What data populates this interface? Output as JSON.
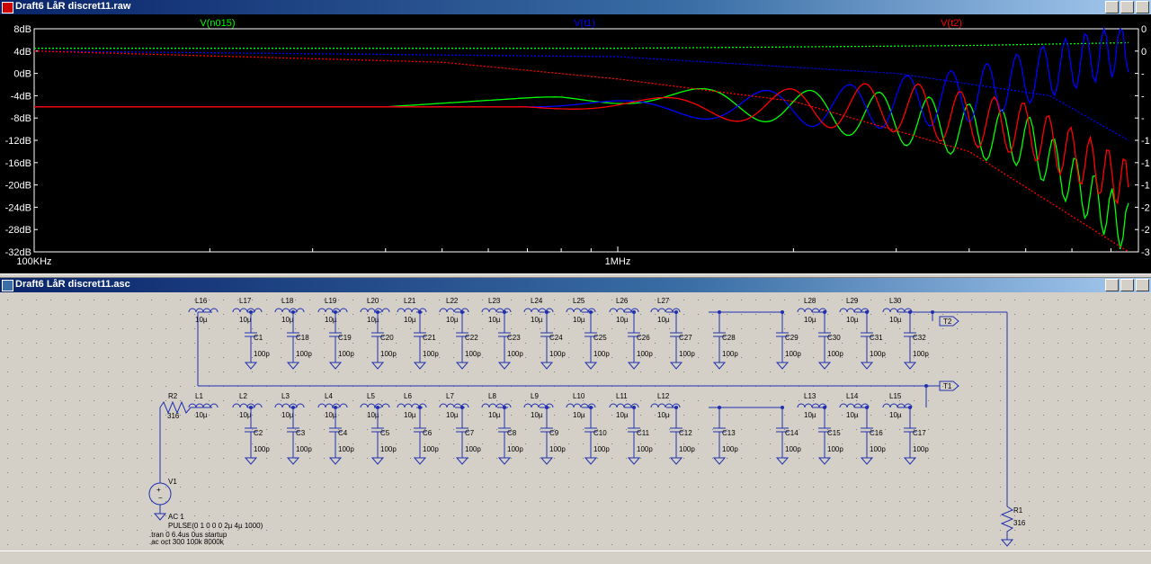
{
  "plot_window": {
    "title": "Draft6 LåR discret11.raw",
    "traces": [
      {
        "name": "V(n015)",
        "color": "#00ff00"
      },
      {
        "name": "V(t1)",
        "color": "#0000ff"
      },
      {
        "name": "V(t2)",
        "color": "#ff0000"
      }
    ],
    "y_ticks": [
      "8dB",
      "4dB",
      "0dB",
      "-4dB",
      "-8dB",
      "-12dB",
      "-16dB",
      "-20dB",
      "-24dB",
      "-28dB",
      "-32dB"
    ],
    "x_ticks": [
      "100KHz",
      "1MHz"
    ],
    "right_ticks": [
      "0",
      "0",
      "-",
      "-",
      "-",
      "-1",
      "-1",
      "-1",
      "-2",
      "-2",
      "-3"
    ]
  },
  "chart_data": {
    "type": "line",
    "xlabel": "",
    "ylabel": "",
    "x_scale": "log",
    "xlim": [
      "100KHz",
      "~8MHz"
    ],
    "ylim": [
      -32,
      8
    ],
    "grid": false,
    "series": [
      {
        "name": "V(n015)",
        "color": "#00ff00",
        "style": "solid",
        "points": [
          [
            100000,
            -6
          ],
          [
            400000,
            -6
          ],
          [
            800000,
            -4
          ],
          [
            1500000,
            -5
          ],
          [
            3000000,
            -8
          ],
          [
            5000000,
            -12
          ],
          [
            7500000,
            -28
          ]
        ]
      },
      {
        "name": "V(n015)",
        "color": "#00ff00",
        "style": "dashed",
        "points": [
          [
            100000,
            4.5
          ],
          [
            1000000,
            4.5
          ],
          [
            4000000,
            5
          ],
          [
            7500000,
            5.5
          ]
        ]
      },
      {
        "name": "V(t1)",
        "color": "#0000ff",
        "style": "solid",
        "points": [
          [
            100000,
            -6
          ],
          [
            1000000,
            -6
          ],
          [
            2500000,
            -6
          ],
          [
            4000000,
            -4
          ],
          [
            7500000,
            5
          ]
        ]
      },
      {
        "name": "V(t1)",
        "color": "#0000ff",
        "style": "dashed",
        "points": [
          [
            100000,
            4
          ],
          [
            1000000,
            3
          ],
          [
            3000000,
            0
          ],
          [
            5500000,
            -4
          ],
          [
            7500000,
            -12
          ]
        ]
      },
      {
        "name": "V(t2)",
        "color": "#ff0000",
        "style": "solid",
        "points": [
          [
            100000,
            -6
          ],
          [
            1000000,
            -6
          ],
          [
            3000000,
            -6
          ],
          [
            5000000,
            -10
          ],
          [
            7500000,
            -20
          ]
        ]
      },
      {
        "name": "V(t2)",
        "color": "#ff0000",
        "style": "dashed",
        "points": [
          [
            100000,
            4
          ],
          [
            500000,
            2
          ],
          [
            1000000,
            -1
          ],
          [
            2000000,
            -5
          ],
          [
            4000000,
            -14
          ],
          [
            7500000,
            -32
          ]
        ]
      }
    ]
  },
  "schematic_window": {
    "title": "Draft6 LåR discret11.asc",
    "top_inductors": [
      "L16",
      "L17",
      "L18",
      "L19",
      "L20",
      "L21",
      "L22",
      "L23",
      "L24",
      "L25",
      "L26",
      "L27",
      "L28",
      "L29",
      "L30"
    ],
    "top_caps": [
      "C1",
      "C18",
      "C19",
      "C20",
      "C21",
      "C22",
      "C23",
      "C24",
      "C25",
      "C26",
      "C27",
      "C28",
      "C29",
      "C30",
      "C31",
      "C32"
    ],
    "bot_inductors": [
      "L1",
      "L2",
      "L3",
      "L4",
      "L5",
      "L6",
      "L7",
      "L8",
      "L9",
      "L10",
      "L11",
      "L12",
      "L13",
      "L14",
      "L15"
    ],
    "bot_caps": [
      "C2",
      "C3",
      "C4",
      "C5",
      "C6",
      "C7",
      "C8",
      "C9",
      "C10",
      "C11",
      "C12",
      "C13",
      "C14",
      "C15",
      "C16",
      "C17"
    ],
    "ind_value": "10µ",
    "cap_value": "100p",
    "r2": {
      "name": "R2",
      "value": "316"
    },
    "r1": {
      "name": "R1",
      "value": "316"
    },
    "v1": {
      "name": "V1",
      "ac": "AC 1",
      "pulse": "PULSE(0 1 0 0 0 2µ 4µ 1000)"
    },
    "directives": [
      ".tran 0 6.4us 0us startup",
      ".ac oct 300 100k 8000k"
    ],
    "labels": {
      "t1": "T1",
      "t2": "T2"
    }
  }
}
